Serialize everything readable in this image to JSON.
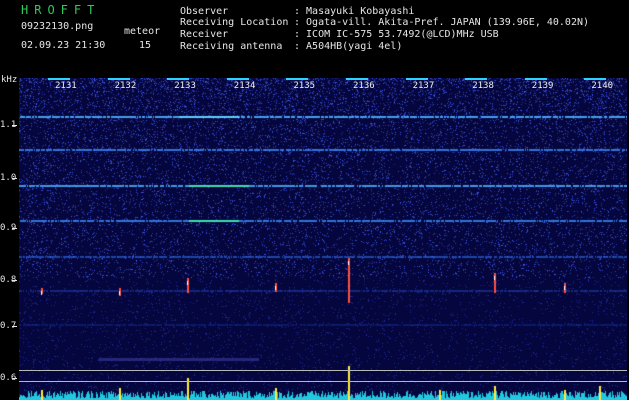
{
  "header": {
    "logo": "HROFFT",
    "filename": "09232130.png",
    "datetime": "02.09.23 21:30",
    "meteor_label": "meteor",
    "meteor_count": "15",
    "observer_label": "Observer",
    "observer_value": ": Masayuki Kobayashi",
    "location_label": "Receiving Location",
    "location_value": ": Ogata-vill. Akita-Pref. JAPAN (139.96E, 40.02N)",
    "receiver_label": "Receiver",
    "receiver_value": ": ICOM IC-575 53.7492(@LCD)MHz USB",
    "antenna_label": "Receiving antenna",
    "antenna_value": ": A504HB(yagi 4el)"
  },
  "axis": {
    "unit": "kHz",
    "y_labels": [
      "1.1",
      "1.0",
      "0.9",
      "0.8",
      "0.7",
      "0.6"
    ],
    "minute_labels": [
      "2131",
      "2132",
      "2133",
      "2134",
      "2135",
      "2136",
      "2137",
      "2138",
      "2139",
      "2140"
    ]
  },
  "colors": {
    "background": "#05063d",
    "noise": "#2c3fd0",
    "carrier": "#3aa0ff",
    "meteor": "#ffea3a",
    "marker": "#2bd4ff"
  }
}
